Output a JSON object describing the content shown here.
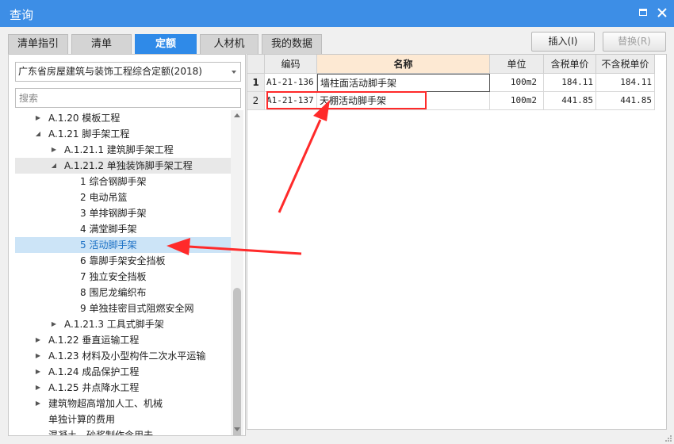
{
  "window": {
    "title": "查询"
  },
  "tabs": [
    {
      "label": "清单指引"
    },
    {
      "label": "清单"
    },
    {
      "label": "定额",
      "active": true
    },
    {
      "label": "人材机"
    },
    {
      "label": "我的数据"
    }
  ],
  "toolbar": {
    "insert_label": "插入(I)",
    "replace_label": "替换(R)"
  },
  "left": {
    "library_selected": "广东省房屋建筑与装饰工程综合定额(2018)",
    "search_placeholder": "搜索",
    "tree": [
      {
        "label": "A.1.20 模板工程",
        "state": "collapsed"
      },
      {
        "label": "A.1.21 脚手架工程",
        "state": "expanded"
      },
      {
        "label": "A.1.21.1 建筑脚手架工程",
        "state": "collapsed"
      },
      {
        "label": "A.1.21.2 单独装饰脚手架工程",
        "state": "expanded"
      },
      {
        "label": "1 综合钢脚手架",
        "state": "leaf"
      },
      {
        "label": "2 电动吊篮",
        "state": "leaf"
      },
      {
        "label": "3 单排钢脚手架",
        "state": "leaf"
      },
      {
        "label": "4 满堂脚手架",
        "state": "leaf"
      },
      {
        "label": "5 活动脚手架",
        "state": "leaf",
        "selected": true
      },
      {
        "label": "6 靠脚手架安全挡板",
        "state": "leaf"
      },
      {
        "label": "7 独立安全挡板",
        "state": "leaf"
      },
      {
        "label": "8 围尼龙编织布",
        "state": "leaf"
      },
      {
        "label": "9 单独挂密目式阻燃安全网",
        "state": "leaf"
      },
      {
        "label": "A.1.21.3 工具式脚手架",
        "state": "collapsed"
      },
      {
        "label": "A.1.22 垂直运输工程",
        "state": "collapsed"
      },
      {
        "label": "A.1.23 材料及小型构件二次水平运输",
        "state": "collapsed"
      },
      {
        "label": "A.1.24 成品保护工程",
        "state": "collapsed"
      },
      {
        "label": "A.1.25 井点降水工程",
        "state": "collapsed"
      },
      {
        "label": "建筑物超高增加人工、机械",
        "state": "collapsed"
      },
      {
        "label": "单独计算的费用",
        "state": "leaf"
      },
      {
        "label": "混凝土、砂浆制作含用去",
        "state": "leaf"
      }
    ]
  },
  "grid": {
    "columns": [
      "编码",
      "名称",
      "单位",
      "含税单价",
      "不含税单价"
    ],
    "rows": [
      {
        "no": "1",
        "code": "A1-21-136",
        "name": "墙柱面活动脚手架",
        "unit": "100m2",
        "price_tax": "184.11",
        "price_notax": "184.11"
      },
      {
        "no": "2",
        "code": "A1-21-137",
        "name": "天棚活动脚手架",
        "unit": "100m2",
        "price_tax": "441.85",
        "price_notax": "441.85"
      }
    ]
  },
  "annotation": {
    "color": "#ff2a2a"
  },
  "colors": {
    "titlebar": "#3d8ee6",
    "active_tab": "#2f8ae8",
    "selection": "#cce4f7"
  }
}
